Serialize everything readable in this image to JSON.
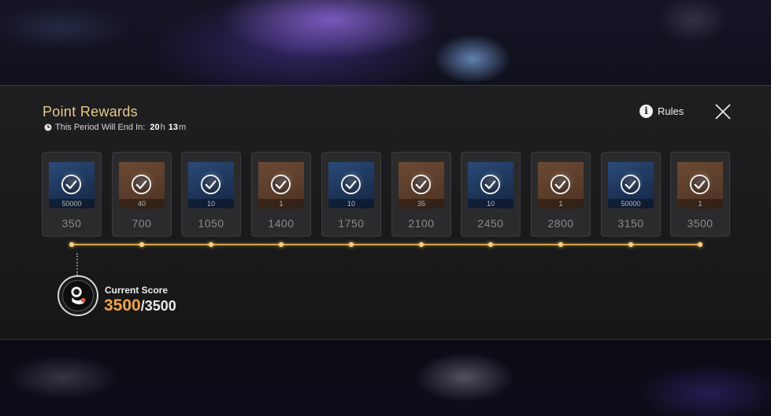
{
  "header": {
    "title": "Point Rewards",
    "period_label": "This Period Will End In:",
    "hours": "20",
    "hours_unit": "h",
    "minutes": "13",
    "minutes_unit": "m",
    "rules_label": "Rules"
  },
  "rewards": [
    {
      "points": "350",
      "quantity": "50000",
      "color": "blue",
      "claimed": true
    },
    {
      "points": "700",
      "quantity": "40",
      "color": "orange",
      "claimed": true
    },
    {
      "points": "1050",
      "quantity": "10",
      "color": "blue",
      "claimed": true
    },
    {
      "points": "1400",
      "quantity": "1",
      "color": "orange",
      "claimed": true
    },
    {
      "points": "1750",
      "quantity": "10",
      "color": "blue",
      "claimed": true
    },
    {
      "points": "2100",
      "quantity": "35",
      "color": "orange",
      "claimed": true
    },
    {
      "points": "2450",
      "quantity": "10",
      "color": "blue",
      "claimed": true
    },
    {
      "points": "2800",
      "quantity": "1",
      "color": "orange",
      "claimed": true
    },
    {
      "points": "3150",
      "quantity": "50000",
      "color": "blue",
      "claimed": true
    },
    {
      "points": "3500",
      "quantity": "1",
      "color": "orange",
      "claimed": true
    }
  ],
  "score": {
    "label": "Current Score",
    "current": "3500",
    "separator": "/",
    "max": "3500",
    "progress_fraction": 1.0
  },
  "colors": {
    "accent_gold": "#e6c98c",
    "score_orange": "#f0a448",
    "progress_gold": "#d4a64d"
  }
}
